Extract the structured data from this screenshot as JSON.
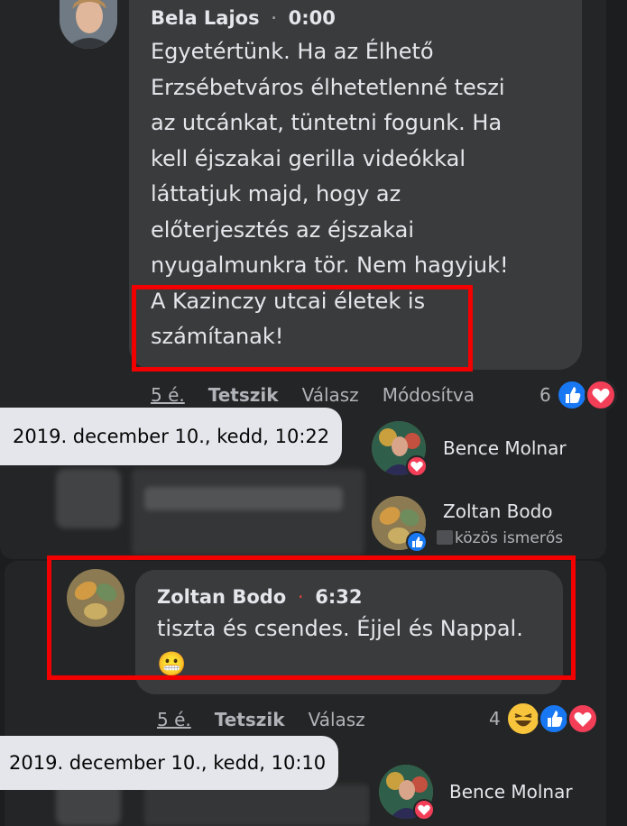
{
  "comment1": {
    "author": "Bela Lajos",
    "time": "0:00",
    "lines": [
      "Egyetértünk. Ha az Élhető",
      "Erzsébetváros élhetetlenné teszi",
      "az utcánkat, tüntetni fogunk. Ha",
      "kell éjszakai gerilla videókkal",
      "láttatjuk majd, hogy az",
      "előterjesztés az éjszakai",
      "nyugalmunkra tör. Nem hagyjuk!",
      "A Kazinczy utcai életek is",
      "számítanak!"
    ],
    "age": "5 é.",
    "like": "Tetszik",
    "reply": "Válasz",
    "edited": "Módosítva",
    "reaction_count": "6",
    "tooltip": "2019. december 10., kedd, 10:22"
  },
  "reactors1": [
    {
      "name": "Bence Molnar",
      "sub": ""
    },
    {
      "name": "Zoltan Bodo",
      "sub": "közös ismerős"
    }
  ],
  "comment2": {
    "author": "Zoltan Bodo",
    "time": "6:32",
    "lines": [
      "tiszta és csendes. Éjjel és Nappal."
    ],
    "emoji": "😬",
    "age": "5 é.",
    "like": "Tetszik",
    "reply": "Válasz",
    "reaction_count": "4",
    "tooltip": "2019. december 10., kedd, 10:10"
  },
  "reactors2": [
    {
      "name": "Bence Molnar"
    }
  ],
  "separator": "·",
  "colors": {
    "like_blue": "#1877f2",
    "love_red": "#f33e58",
    "highlight_red": "#f20000"
  }
}
